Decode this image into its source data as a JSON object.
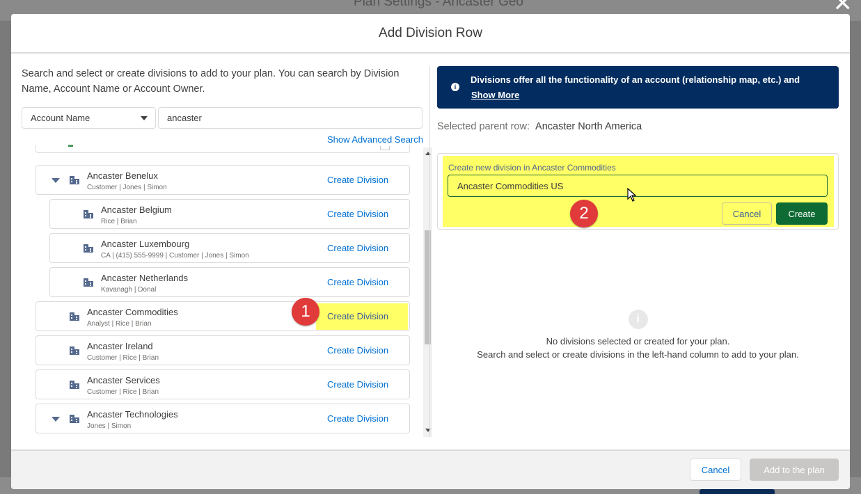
{
  "background": {
    "title": "Plan Settings - Ancaster Geo",
    "close_glyph": "✕"
  },
  "modal": {
    "title": "Add Division Row",
    "footer": {
      "cancel_label": "Cancel",
      "add_label": "Add to the plan"
    }
  },
  "left": {
    "intro": "Search and select or create divisions to add to your plan. You can search by Division Name, Account Name or Account Owner.",
    "search": {
      "field_select": "Account Name",
      "query": "ancaster"
    },
    "advanced_link": "Show Advanced Search",
    "rows": [
      {
        "name": "Ancaster Benelux",
        "meta": "Customer | Jones | Simon",
        "action": "Create Division"
      },
      {
        "name": "Ancaster Belgium",
        "meta": "Rice | Brian",
        "action": "Create Division"
      },
      {
        "name": "Ancaster Luxembourg",
        "meta": "CA | (415) 555-9999 | Customer | Jones | Simon",
        "action": "Create Division"
      },
      {
        "name": "Ancaster Netherlands",
        "meta": "Kavanagh | Donal",
        "action": "Create Division"
      },
      {
        "name": "Ancaster Commodities",
        "meta": "Analyst | Rice | Brian",
        "action": "Create Division"
      },
      {
        "name": "Ancaster Ireland",
        "meta": "Customer | Rice | Brian",
        "action": "Create Division"
      },
      {
        "name": "Ancaster Services",
        "meta": "Customer | Rice | Brian",
        "action": "Create Division"
      },
      {
        "name": "Ancaster Technologies",
        "meta": "Jones | Simon",
        "action": "Create Division"
      }
    ]
  },
  "right": {
    "banner": {
      "text": "Divisions offer all the functionality of an account (relationship map, etc.) and",
      "more": "Show More"
    },
    "selected_parent": {
      "label": "Selected parent row:",
      "value": "Ancaster North America"
    },
    "create_form": {
      "label": "Create new division in Ancaster Commodities",
      "value": "Ancaster Commodities US",
      "cancel_label": "Cancel",
      "create_label": "Create"
    },
    "empty": {
      "icon_glyph": "i",
      "line1": "No divisions selected or created for your plan.",
      "line2": "Search and select or create divisions in the left-hand column to add to your plan."
    }
  },
  "annotations": {
    "step1": "1",
    "step2": "2"
  },
  "colors": {
    "banner_bg": "#032d60",
    "link": "#0070d2",
    "highlight": "#ffff66",
    "create_button": "#0e6b34",
    "badge": "#e03a3a"
  }
}
